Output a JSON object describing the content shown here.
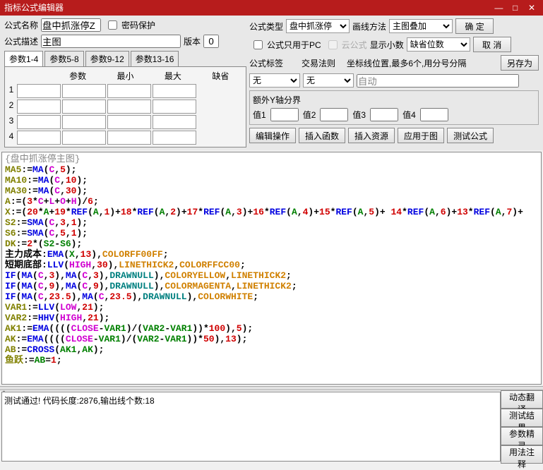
{
  "title": "指标公式编辑器",
  "labels": {
    "name": "公式名称",
    "pwd": "密码保护",
    "type": "公式类型",
    "drawMethod": "画线方法",
    "desc": "公式描述",
    "version": "版本",
    "pcOnly": "公式只用于PC",
    "cloud": "云公式",
    "showDec": "显示小数",
    "defDigits": "缺省位数",
    "tag": "公式标签",
    "rule": "交易法则",
    "coordPos": "坐标线位置,最多6个,用分号分隔",
    "extraY": "额外Y轴分界",
    "val1": "值1",
    "val2": "值2",
    "val3": "值3",
    "val4": "值4"
  },
  "buttons": {
    "ok": "确  定",
    "cancel": "取  消",
    "saveAs": "另存为",
    "editOp": "编辑操作",
    "insFunc": "插入函数",
    "insRes": "插入资源",
    "applyTo": "应用于图",
    "testFormula": "测试公式",
    "dynTrans": "动态翻译",
    "testRes": "测试结果",
    "paramWiz": "参数精灵",
    "usage": "用法注释"
  },
  "fields": {
    "name": "盘中抓涨停Z",
    "desc": "主图",
    "version": "0",
    "type": "盘中抓涨停",
    "drawMethod": "主图叠加",
    "defDigits": "缺省位数",
    "tag": "无",
    "rule": "无",
    "coord": "自动"
  },
  "paramTabs": [
    "参数1-4",
    "参数5-8",
    "参数9-12",
    "参数13-16"
  ],
  "paramHdrs": [
    "参数",
    "最小",
    "最大",
    "缺省"
  ],
  "codeTitle": "{盘中抓涨停主图}",
  "code": [
    {
      "t": [
        [
          "olive",
          "MA5"
        ],
        [
          "blk",
          ":="
        ],
        [
          "blue",
          "MA"
        ],
        [
          "blk",
          "("
        ],
        [
          "mag",
          "C"
        ],
        [
          "blk",
          ","
        ],
        [
          "red",
          "5"
        ],
        [
          "blk",
          ");"
        ]
      ]
    },
    {
      "t": [
        [
          "olive",
          "MA10"
        ],
        [
          "blk",
          ":="
        ],
        [
          "blue",
          "MA"
        ],
        [
          "blk",
          "("
        ],
        [
          "mag",
          "C"
        ],
        [
          "blk",
          ","
        ],
        [
          "red",
          "10"
        ],
        [
          "blk",
          ");"
        ]
      ]
    },
    {
      "t": [
        [
          "olive",
          "MA30"
        ],
        [
          "blk",
          ":="
        ],
        [
          "blue",
          "MA"
        ],
        [
          "blk",
          "("
        ],
        [
          "mag",
          "C"
        ],
        [
          "blk",
          ","
        ],
        [
          "red",
          "30"
        ],
        [
          "blk",
          ");"
        ]
      ]
    },
    {
      "t": [
        [
          "olive",
          "A"
        ],
        [
          "blk",
          ":=("
        ],
        [
          "red",
          "3"
        ],
        [
          "blk",
          "*"
        ],
        [
          "mag",
          "C"
        ],
        [
          "blk",
          "+"
        ],
        [
          "mag",
          "L"
        ],
        [
          "blk",
          "+"
        ],
        [
          "mag",
          "O"
        ],
        [
          "blk",
          "+"
        ],
        [
          "mag",
          "H"
        ],
        [
          "blk",
          ")/"
        ],
        [
          "red",
          "6"
        ],
        [
          "blk",
          ";"
        ]
      ]
    },
    {
      "t": [
        [
          "olive",
          "X"
        ],
        [
          "blk",
          ":=("
        ],
        [
          "red",
          "20"
        ],
        [
          "blk",
          "*"
        ],
        [
          "grn",
          "A"
        ],
        [
          "blk",
          "+"
        ],
        [
          "red",
          "19"
        ],
        [
          "blk",
          "*"
        ],
        [
          "blue",
          "REF"
        ],
        [
          "blk",
          "("
        ],
        [
          "grn",
          "A"
        ],
        [
          "blk",
          ","
        ],
        [
          "red",
          "1"
        ],
        [
          "blk",
          ")+"
        ],
        [
          "red",
          "18"
        ],
        [
          "blk",
          "*"
        ],
        [
          "blue",
          "REF"
        ],
        [
          "blk",
          "("
        ],
        [
          "grn",
          "A"
        ],
        [
          "blk",
          ","
        ],
        [
          "red",
          "2"
        ],
        [
          "blk",
          ")+"
        ],
        [
          "red",
          "17"
        ],
        [
          "blk",
          "*"
        ],
        [
          "blue",
          "REF"
        ],
        [
          "blk",
          "("
        ],
        [
          "grn",
          "A"
        ],
        [
          "blk",
          ","
        ],
        [
          "red",
          "3"
        ],
        [
          "blk",
          ")+"
        ],
        [
          "red",
          "16"
        ],
        [
          "blk",
          "*"
        ],
        [
          "blue",
          "REF"
        ],
        [
          "blk",
          "("
        ],
        [
          "grn",
          "A"
        ],
        [
          "blk",
          ","
        ],
        [
          "red",
          "4"
        ],
        [
          "blk",
          ")+"
        ],
        [
          "red",
          "15"
        ],
        [
          "blk",
          "*"
        ],
        [
          "blue",
          "REF"
        ],
        [
          "blk",
          "("
        ],
        [
          "grn",
          "A"
        ],
        [
          "blk",
          ","
        ],
        [
          "red",
          "5"
        ],
        [
          "blk",
          ")+ "
        ],
        [
          "red",
          "14"
        ],
        [
          "blk",
          "*"
        ],
        [
          "blue",
          "REF"
        ],
        [
          "blk",
          "("
        ],
        [
          "grn",
          "A"
        ],
        [
          "blk",
          ","
        ],
        [
          "red",
          "6"
        ],
        [
          "blk",
          ")+"
        ],
        [
          "red",
          "13"
        ],
        [
          "blk",
          "*"
        ],
        [
          "blue",
          "REF"
        ],
        [
          "blk",
          "("
        ],
        [
          "grn",
          "A"
        ],
        [
          "blk",
          ","
        ],
        [
          "red",
          "7"
        ],
        [
          "blk",
          ")+"
        ]
      ]
    },
    {
      "t": [
        [
          "olive",
          "S2"
        ],
        [
          "blk",
          ":="
        ],
        [
          "blue",
          "SMA"
        ],
        [
          "blk",
          "("
        ],
        [
          "mag",
          "C"
        ],
        [
          "blk",
          ","
        ],
        [
          "red",
          "3"
        ],
        [
          "blk",
          ","
        ],
        [
          "red",
          "1"
        ],
        [
          "blk",
          ");"
        ]
      ]
    },
    {
      "t": [
        [
          "olive",
          "S6"
        ],
        [
          "blk",
          ":="
        ],
        [
          "blue",
          "SMA"
        ],
        [
          "blk",
          "("
        ],
        [
          "mag",
          "C"
        ],
        [
          "blk",
          ","
        ],
        [
          "red",
          "5"
        ],
        [
          "blk",
          ","
        ],
        [
          "red",
          "1"
        ],
        [
          "blk",
          ");"
        ]
      ]
    },
    {
      "t": [
        [
          "olive",
          "DK"
        ],
        [
          "blk",
          ":="
        ],
        [
          "red",
          "2"
        ],
        [
          "blk",
          "*("
        ],
        [
          "grn",
          "S2"
        ],
        [
          "blk",
          "-"
        ],
        [
          "grn",
          "S6"
        ],
        [
          "blk",
          ");"
        ]
      ]
    },
    {
      "t": [
        [
          "blk",
          "主力成本:"
        ],
        [
          "blue",
          "EMA"
        ],
        [
          "blk",
          "("
        ],
        [
          "grn",
          "X"
        ],
        [
          "blk",
          ","
        ],
        [
          "red",
          "13"
        ],
        [
          "blk",
          ")"
        ],
        [
          "blk",
          ","
        ],
        [
          "org",
          "COLORFF00FF"
        ],
        [
          "blk",
          ";"
        ]
      ]
    },
    {
      "t": [
        [
          "blk",
          "短期底部:"
        ],
        [
          "blue",
          "LLV"
        ],
        [
          "blk",
          "("
        ],
        [
          "mag",
          "HIGH"
        ],
        [
          "blk",
          ","
        ],
        [
          "red",
          "30"
        ],
        [
          "blk",
          ")"
        ],
        [
          "blk",
          ","
        ],
        [
          "org",
          "LINETHICK2"
        ],
        [
          "blk",
          ","
        ],
        [
          "org",
          "COLORFFCC00"
        ],
        [
          "blk",
          ";"
        ]
      ]
    },
    {
      "t": [
        [
          "blue",
          "IF"
        ],
        [
          "blk",
          "("
        ],
        [
          "blue",
          "MA"
        ],
        [
          "blk",
          "("
        ],
        [
          "mag",
          "C"
        ],
        [
          "blk",
          ","
        ],
        [
          "red",
          "3"
        ],
        [
          "blk",
          "),"
        ],
        [
          "blue",
          "MA"
        ],
        [
          "blk",
          "("
        ],
        [
          "mag",
          "C"
        ],
        [
          "blk",
          ","
        ],
        [
          "red",
          "3"
        ],
        [
          "blk",
          "),"
        ],
        [
          "cyn",
          "DRAWNULL"
        ],
        [
          "blk",
          "),"
        ],
        [
          "org",
          "COLORYELLOW"
        ],
        [
          "blk",
          ","
        ],
        [
          "org",
          "LINETHICK2"
        ],
        [
          "blk",
          ";"
        ]
      ]
    },
    {
      "t": [
        [
          "blue",
          "IF"
        ],
        [
          "blk",
          "("
        ],
        [
          "blue",
          "MA"
        ],
        [
          "blk",
          "("
        ],
        [
          "mag",
          "C"
        ],
        [
          "blk",
          ","
        ],
        [
          "red",
          "9"
        ],
        [
          "blk",
          "),"
        ],
        [
          "blue",
          "MA"
        ],
        [
          "blk",
          "("
        ],
        [
          "mag",
          "C"
        ],
        [
          "blk",
          ","
        ],
        [
          "red",
          "9"
        ],
        [
          "blk",
          "),"
        ],
        [
          "cyn",
          "DRAWNULL"
        ],
        [
          "blk",
          "),"
        ],
        [
          "org",
          "COLORMAGENTA"
        ],
        [
          "blk",
          ","
        ],
        [
          "org",
          "LINETHICK2"
        ],
        [
          "blk",
          ";"
        ]
      ]
    },
    {
      "t": [
        [
          "blue",
          "IF"
        ],
        [
          "blk",
          "("
        ],
        [
          "blue",
          "MA"
        ],
        [
          "blk",
          "("
        ],
        [
          "mag",
          "C"
        ],
        [
          "blk",
          ","
        ],
        [
          "red",
          "23.5"
        ],
        [
          "blk",
          "),"
        ],
        [
          "blue",
          "MA"
        ],
        [
          "blk",
          "("
        ],
        [
          "mag",
          "C"
        ],
        [
          "blk",
          ","
        ],
        [
          "red",
          "23.5"
        ],
        [
          "blk",
          "),"
        ],
        [
          "cyn",
          "DRAWNULL"
        ],
        [
          "blk",
          "),"
        ],
        [
          "org",
          "COLORWHITE"
        ],
        [
          "blk",
          ";"
        ]
      ]
    },
    {
      "t": [
        [
          "olive",
          "VAR1"
        ],
        [
          "blk",
          ":="
        ],
        [
          "blue",
          "LLV"
        ],
        [
          "blk",
          "("
        ],
        [
          "mag",
          "LOW"
        ],
        [
          "blk",
          ","
        ],
        [
          "red",
          "21"
        ],
        [
          "blk",
          ");"
        ]
      ]
    },
    {
      "t": [
        [
          "olive",
          "VAR2"
        ],
        [
          "blk",
          ":="
        ],
        [
          "blue",
          "HHV"
        ],
        [
          "blk",
          "("
        ],
        [
          "mag",
          "HIGH"
        ],
        [
          "blk",
          ","
        ],
        [
          "red",
          "21"
        ],
        [
          "blk",
          ");"
        ]
      ]
    },
    {
      "t": [
        [
          "olive",
          "AK1"
        ],
        [
          "blk",
          ":="
        ],
        [
          "blue",
          "EMA"
        ],
        [
          "blk",
          "(((("
        ],
        [
          "mag",
          "CLOSE"
        ],
        [
          "blk",
          "-"
        ],
        [
          "grn",
          "VAR1"
        ],
        [
          "blk",
          ")/("
        ],
        [
          "grn",
          "VAR2"
        ],
        [
          "blk",
          "-"
        ],
        [
          "grn",
          "VAR1"
        ],
        [
          "blk",
          "))*"
        ],
        [
          "red",
          "100"
        ],
        [
          "blk",
          "),"
        ],
        [
          "red",
          "5"
        ],
        [
          "blk",
          ");"
        ]
      ]
    },
    {
      "t": [
        [
          "olive",
          "AK"
        ],
        [
          "blk",
          ":="
        ],
        [
          "blue",
          "EMA"
        ],
        [
          "blk",
          "(((("
        ],
        [
          "mag",
          "CLOSE"
        ],
        [
          "blk",
          "-"
        ],
        [
          "grn",
          "VAR1"
        ],
        [
          "blk",
          ")/("
        ],
        [
          "grn",
          "VAR2"
        ],
        [
          "blk",
          "-"
        ],
        [
          "grn",
          "VAR1"
        ],
        [
          "blk",
          "))*"
        ],
        [
          "red",
          "50"
        ],
        [
          "blk",
          "),"
        ],
        [
          "red",
          "13"
        ],
        [
          "blk",
          ");"
        ]
      ]
    },
    {
      "t": [
        [
          "olive",
          "AB"
        ],
        [
          "blk",
          ":="
        ],
        [
          "blue",
          "CROSS"
        ],
        [
          "blk",
          "("
        ],
        [
          "grn",
          "AK1"
        ],
        [
          "blk",
          ","
        ],
        [
          "grn",
          "AK"
        ],
        [
          "blk",
          ");"
        ]
      ]
    },
    {
      "t": [
        [
          "olive",
          "鱼跃"
        ],
        [
          "blk",
          ":="
        ],
        [
          "grn",
          "AB"
        ],
        [
          "blk",
          "="
        ],
        [
          "red",
          "1"
        ],
        [
          "blk",
          ";"
        ]
      ]
    }
  ],
  "output": "测试通过! 代码长度:2876,输出线个数:18"
}
